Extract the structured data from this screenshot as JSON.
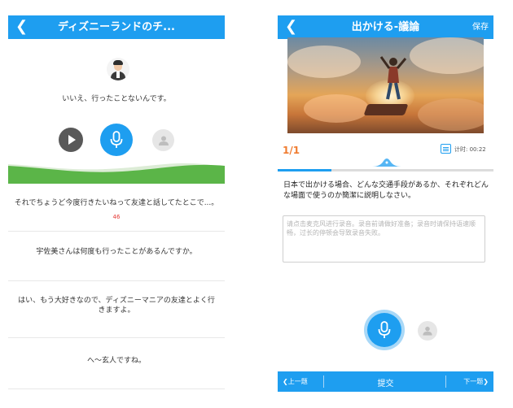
{
  "left_screen": {
    "header": {
      "title": "ディズニーランドのチ..."
    },
    "speaker_line": "いいえ、行ったことないんです。",
    "dialogue": [
      {
        "text": "それでちょうど今度行きたいねって友達と話してたとこで...。",
        "score": "46"
      },
      {
        "text": "宇佐美さんは何度も行ったことがあるんですか。"
      },
      {
        "text": "はい、もう大好きなので、ディズニーマニアの友達とよく行きますよ。"
      },
      {
        "text": "へ〜玄人ですね。"
      }
    ],
    "colors": {
      "header": "#1e9ef0",
      "wave_green": "#5bb548",
      "score": "#e53935"
    }
  },
  "right_screen": {
    "header": {
      "title": "出かける-議論",
      "save": "保存"
    },
    "counter": "1/1",
    "timer": "计时: 00:22",
    "progress": 0.25,
    "question": "日本で出かける場合、どんな交通手段があるか、それぞれどんな場面で使うのか簡潔に説明しなさい。",
    "answer_placeholder": "请点击麦克风进行录音。录音前请做好准备；录音时请保持语速顺畅，过长的停顿会导致录音失败。",
    "bottom_bar": {
      "prev": "上一题",
      "submit": "提交",
      "next": "下一题"
    },
    "colors": {
      "accent": "#1e9ef0",
      "counter": "#f07c30"
    }
  }
}
